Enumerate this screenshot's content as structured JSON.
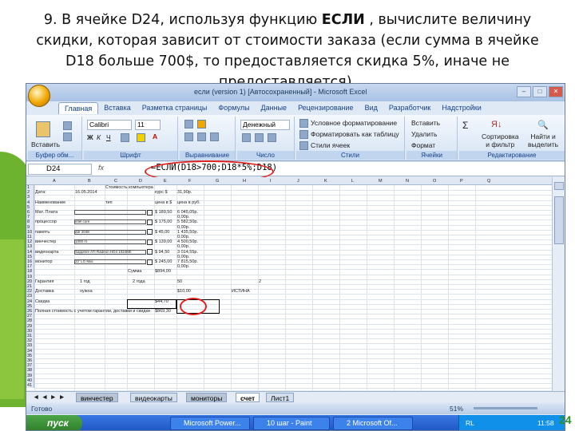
{
  "task": {
    "line1_prefix": "9. В ячейке D24, используя функцию ",
    "line1_bold": "ЕСЛИ",
    "line1_suffix": " , вычислите величину",
    "line2": "скидки, которая зависит от стоимости заказа (если сумма в ячейке",
    "line3": "D18 больше 700$, то предоставляется скидка 5%, иначе не",
    "line4": "предоставляется)."
  },
  "window": {
    "title": "если (version 1) [Автосохраненный] - Microsoft Excel"
  },
  "tabs": [
    "Главная",
    "Вставка",
    "Разметка страницы",
    "Формулы",
    "Данные",
    "Рецензирование",
    "Вид",
    "Разработчик",
    "Надстройки"
  ],
  "ribbon": {
    "clipboard": {
      "label": "Буфер обм...",
      "paste": "Вставить"
    },
    "font": {
      "label": "Шрифт",
      "name": "Calibri",
      "size": "11"
    },
    "alignment": {
      "label": "Выравнивание"
    },
    "number": {
      "label": "Число",
      "format": "Денежный"
    },
    "styles": {
      "label": "Стили",
      "cond": "Условное форматирование",
      "table": "Форматировать как таблицу",
      "cell": "Стили ячеек"
    },
    "cells": {
      "label": "Ячейки",
      "insert": "Вставить",
      "delete": "Удалить",
      "format": "Формат"
    },
    "editing": {
      "label": "Редактирование",
      "sort": "Сортировка\nи фильтр",
      "find": "Найти и\nвыделить"
    }
  },
  "formula_bar": {
    "name_box": "D24",
    "fx": "fx",
    "formula": "=ЕСЛИ(D18>700;D18*5%;D18)"
  },
  "sheet": {
    "columns": [
      "A",
      "B",
      "C",
      "D",
      "E",
      "F",
      "G",
      "H",
      "I",
      "J",
      "K",
      "L",
      "M",
      "N",
      "O",
      "P",
      "Q"
    ],
    "rows": [
      "1",
      "2",
      "3",
      "4",
      "5",
      "6",
      "7",
      "8",
      "9",
      "10",
      "11",
      "12",
      "13",
      "14",
      "15",
      "16",
      "17",
      "18",
      "19",
      "20",
      "21",
      "22",
      "23",
      "24",
      "25",
      "26",
      "27",
      "28",
      "29",
      "30",
      "31",
      "32",
      "33",
      "34",
      "35",
      "36",
      "37",
      "38",
      "39",
      "40",
      "41"
    ],
    "cells": {
      "title": "Стоимость компьютера",
      "date_label": "Дата:",
      "date_value": "16.05.2014",
      "rate_label": "курс $",
      "rate_value": "31,90р.",
      "h_name": "Наименование",
      "h_type": "тип",
      "h_price": "цена в $",
      "h_rub": "цена в руб.",
      "r1_label": "Мат. Плата",
      "r1_usd": "$ 189,50",
      "r1_rub": "6 045,05р.",
      "r2_label": "процессор",
      "r2_model": "intel core",
      "r2_usd": "$ 175,00",
      "r2_rub": "5 582,50р.",
      "r3_label": "память",
      "r3_model": "ddr 2048",
      "r3_usd": "$ 45,00",
      "r3_rub": "1 435,50р.",
      "r4_label": "винчестер",
      "r4_model": "1000 гб",
      "r4_usd": "$ 139,00",
      "r4_rub": "4 500,50р.",
      "r5_label": "видеокарта",
      "r5_model": "Sapphire ATI Radeon HD4 1024Mb",
      "r5_usd": "$ 94,50",
      "r5_rub": "3 014,55р.",
      "r6_label": "монитор",
      "r6_model": "22' LG Mac",
      "r6_usd": "$ 245,00",
      "r6_rub": "7 815,50р.",
      "zero": "0,00р.",
      "sum_label": "Сумма",
      "sum_value": "$894,00",
      "warranty": "Гарантия",
      "opt1": "1 год",
      "opt2": "2 года",
      "w_val": "50",
      "w_num": "2",
      "delivery": "Доставка",
      "delivery_opt": "нужна",
      "delivery_val": "$10,00",
      "delivery_flag": "ИСТИНА",
      "discount": "Скидка",
      "discount_val": "$44,70",
      "total": "Полная стоимость с учетом гарантии, доставки и скидки",
      "total_val": "$869,30"
    }
  },
  "sheet_tabs": [
    "винчестер",
    "видеокарты",
    "мониторы",
    "счет",
    "Лист1"
  ],
  "status": {
    "ready": "Готово",
    "zoom": "51%"
  },
  "taskbar": {
    "start": "пуск",
    "items": [
      "Microsoft Power...",
      "10 шаг - Paint",
      "2 Microsoft Of..."
    ],
    "lang": "RL",
    "time": "11:58"
  },
  "page_number": "24"
}
